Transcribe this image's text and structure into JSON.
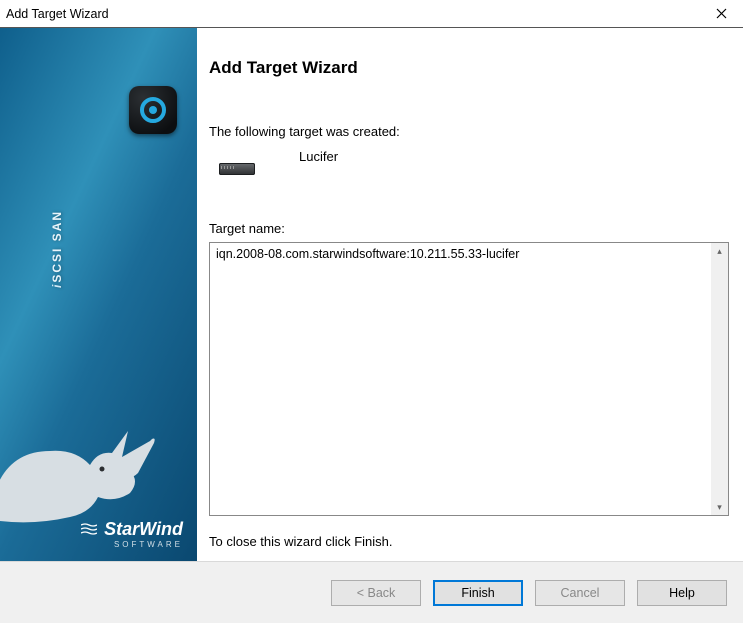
{
  "window": {
    "title": "Add Target Wizard"
  },
  "sidebar": {
    "product": "iSCSI SAN",
    "brand": "StarWind",
    "brand_tag": "SOFTWARE"
  },
  "main": {
    "heading": "Add Target Wizard",
    "subtext": "The following target was created:",
    "created_name": "Lucifer",
    "target_label": "Target name:",
    "target_value": "iqn.2008-08.com.starwindsoftware:10.211.55.33-lucifer",
    "closing_text": "To close this wizard click Finish."
  },
  "buttons": {
    "back": "< Back",
    "finish": "Finish",
    "cancel": "Cancel",
    "help": "Help"
  }
}
